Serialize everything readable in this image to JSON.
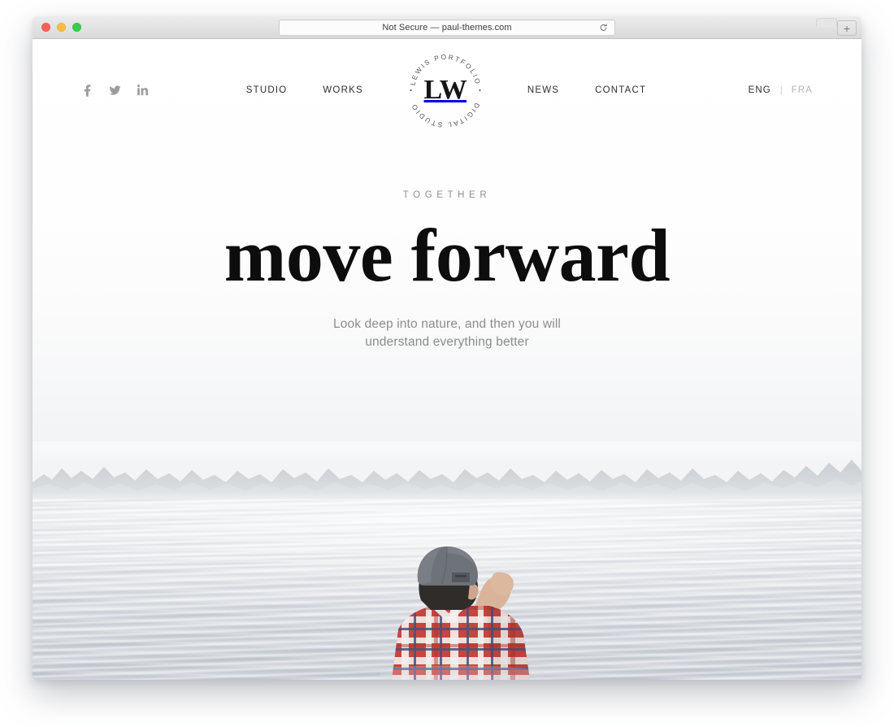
{
  "browser": {
    "address_text": "Not Secure — paul-themes.com",
    "reload_icon": "reload-icon",
    "new_tab_label": "+",
    "traffic_lights": [
      "close",
      "minimize",
      "maximize"
    ],
    "colors": {
      "close": "#fb6058",
      "minimize": "#fcbe40",
      "maximize": "#35cd4b",
      "chrome_bg": "#e6e6e6"
    }
  },
  "header": {
    "social": [
      {
        "name": "facebook-icon",
        "label": "f"
      },
      {
        "name": "twitter-icon",
        "label": "t"
      },
      {
        "name": "linkedin-icon",
        "label": "in"
      }
    ],
    "nav_left": [
      {
        "label": "STUDIO"
      },
      {
        "label": "WORKS"
      }
    ],
    "nav_right": [
      {
        "label": "NEWS"
      },
      {
        "label": "CONTACT"
      }
    ],
    "logo": {
      "monogram": "LW",
      "ring_top": "LEWIS PORTFOLIO",
      "ring_bottom": "DIGITAL STUDIO",
      "bullet": "•"
    },
    "languages": {
      "active": "ENG",
      "divider": "|",
      "inactive": "FRA"
    }
  },
  "hero": {
    "eyebrow": "TOGETHER",
    "title": "move forward",
    "subtitle_line1": "Look deep into nature, and then you will",
    "subtitle_line2": "understand everything better",
    "colors": {
      "title": "#0d0d0d",
      "eyebrow": "#8f8f8f",
      "subtitle": "#8c8c8c"
    }
  },
  "photo": {
    "scene": "misty lake with man in plaid shirt shielding eyes",
    "sky_color": "#fbfbfc",
    "water_color": "#dfe2e7",
    "treeline_color": "#9aa4ab",
    "subject": {
      "cap_color": "#6d7279",
      "hair_color": "#2e2b29",
      "skin_color": "#d8b299",
      "shirt_red": "#c9453f",
      "shirt_white": "#f0eeec",
      "shirt_blue": "#4a4f7a"
    }
  }
}
